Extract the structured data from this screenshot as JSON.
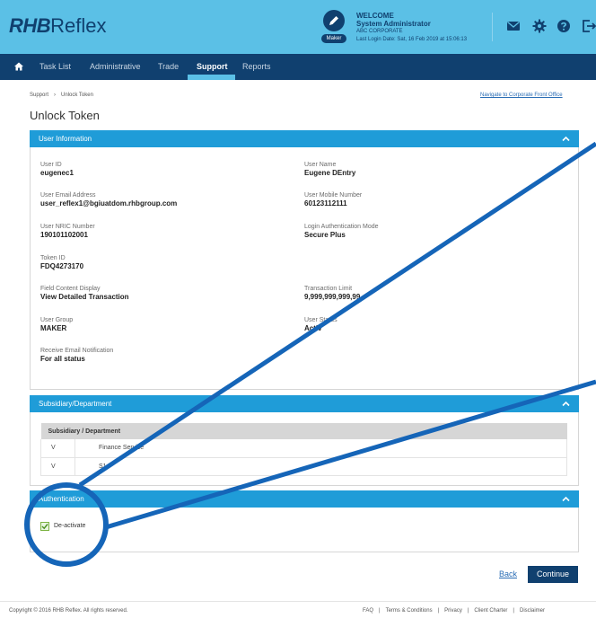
{
  "header": {
    "logo_rhb": "RHB",
    "logo_reflex": "Reflex",
    "role_badge": "Maker",
    "welcome": "WELCOME",
    "user_name": "System Administrator",
    "company": "ABC CORPORATE",
    "last_login": "Last Login Date: Sat, 16 Feb 2019 at 15:06:13",
    "icons": [
      "mail-icon",
      "gear-icon",
      "help-icon",
      "logout-icon"
    ]
  },
  "nav": {
    "items": [
      "Task List",
      "Administrative",
      "Trade",
      "Support",
      "Reports"
    ],
    "active": "Support"
  },
  "breadcrumb": {
    "root": "Support",
    "sep": "›",
    "current": "Unlock Token"
  },
  "corporate_link": "Navigate to Corporate Front Office",
  "page_title": "Unlock Token",
  "user_info": {
    "title": "User Information",
    "fields": [
      {
        "label": "User ID",
        "value": "eugenec1"
      },
      {
        "label": "User Name",
        "value": "Eugene DEntry"
      },
      {
        "label": "User Email Address",
        "value": "user_reflex1@bgiuatdom.rhbgroup.com"
      },
      {
        "label": "User Mobile Number",
        "value": "60123112111"
      },
      {
        "label": "User NRIC Number",
        "value": "190101102001"
      },
      {
        "label": "Login Authentication Mode",
        "value": "Secure Plus"
      },
      {
        "label": "Token ID",
        "value": "FDQ4273170"
      },
      {
        "label": "Field Content Display",
        "value": "View Detailed Transaction"
      },
      {
        "label": "Transaction Limit",
        "value": "9,999,999,999,99"
      },
      {
        "label": "User Group",
        "value": "MAKER"
      },
      {
        "label": "User Status",
        "value": "Activ"
      },
      {
        "label": "Receive Email Notification",
        "value": "For all status"
      }
    ]
  },
  "subsidiary": {
    "title": "Subsidiary/Department",
    "column": "Subsidiary / Department",
    "rows": [
      {
        "flag": "V",
        "name": "Finance Service"
      },
      {
        "flag": "V",
        "name": "S1"
      }
    ]
  },
  "authentication": {
    "title": "Authentication",
    "checkbox_label": "De-activate",
    "checked": true
  },
  "actions": {
    "back": "Back",
    "continue": "Continue"
  },
  "footer": {
    "copyright": "Copyright © 2016 RHB Reflex. All rights reserved.",
    "links": [
      "FAQ",
      "Terms & Conditions",
      "Privacy",
      "Client Charter",
      "Disclaimer"
    ]
  },
  "colors": {
    "header_bg": "#5bc0e6",
    "nav_bg": "#10406f",
    "panel_header": "#1f9cd8",
    "annotation": "#1565b8",
    "checkbox": "#7cb342"
  }
}
